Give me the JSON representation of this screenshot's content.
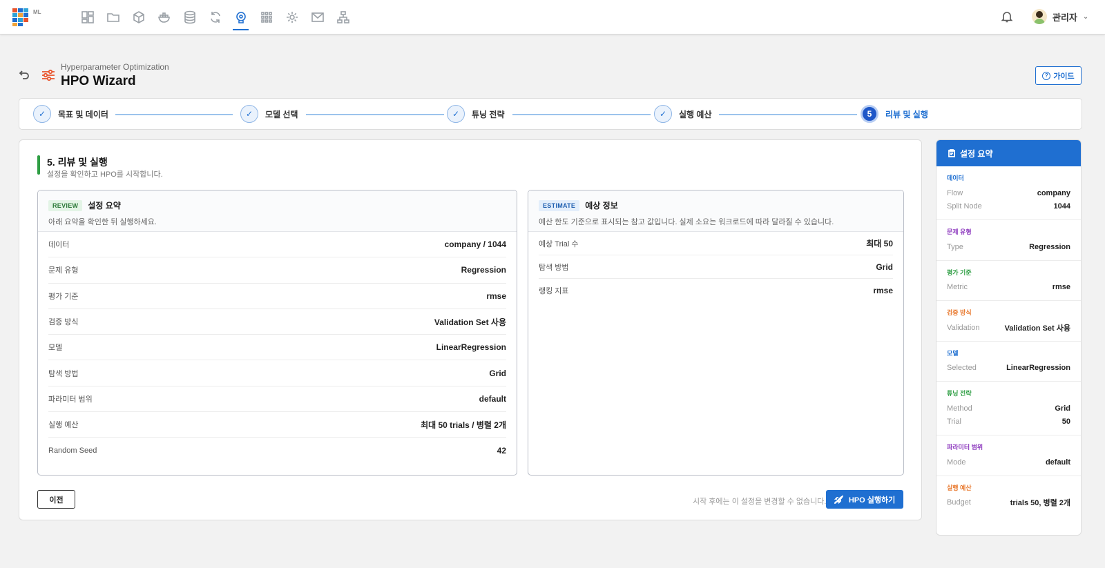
{
  "app": {
    "logo_suffix": "ML",
    "nav_icons": [
      "dashboard-icon",
      "folder-icon",
      "cube-icon",
      "docker-icon",
      "database-icon",
      "sync-icon",
      "brain-icon",
      "apps-grid-icon",
      "settings-icon",
      "mail-icon",
      "network-icon"
    ],
    "active_nav": "brain-icon",
    "user_name": "관리자"
  },
  "header": {
    "subtitle": "Hyperparameter Optimization",
    "title": "HPO Wizard",
    "guide_label": "가이드"
  },
  "stepper": {
    "steps": [
      {
        "label": "목표 및 데이터",
        "status": "done"
      },
      {
        "label": "모델 선택",
        "status": "done"
      },
      {
        "label": "튜닝 전략",
        "status": "done"
      },
      {
        "label": "실행 예산",
        "status": "done"
      },
      {
        "label": "리뷰 및 실행",
        "status": "current",
        "number": "5"
      }
    ]
  },
  "section": {
    "title": "5. 리뷰 및 실행",
    "subtitle": "설정을 확인하고 HPO를 시작합니다."
  },
  "review_panel": {
    "badge": "REVIEW",
    "title": "설정 요약",
    "desc": "아래 요약을 확인한 뒤 실행하세요.",
    "rows": [
      {
        "key": "데이터",
        "value": "company / 1044"
      },
      {
        "key": "문제 유형",
        "value": "Regression"
      },
      {
        "key": "평가 기준",
        "value": "rmse"
      },
      {
        "key": "검증 방식",
        "value": "Validation Set 사용"
      },
      {
        "key": "모델",
        "value": "LinearRegression"
      },
      {
        "key": "탐색 방법",
        "value": "Grid"
      },
      {
        "key": "파라미터 범위",
        "value": "default"
      },
      {
        "key": "실행 예산",
        "value": "최대 50 trials / 병렬 2개"
      },
      {
        "key": "Random Seed",
        "value": "42"
      }
    ]
  },
  "estimate_panel": {
    "badge": "ESTIMATE",
    "title": "예상 정보",
    "desc": "예산 한도 기준으로 표시되는 참고 값입니다. 실제 소요는 워크로드에 따라 달라질 수 있습니다.",
    "rows": [
      {
        "key": "예상 Trial 수",
        "value": "최대 50"
      },
      {
        "key": "탐색 방법",
        "value": "Grid"
      },
      {
        "key": "랭킹 지표",
        "value": "rmse"
      }
    ]
  },
  "actions": {
    "prev_label": "이전",
    "warning": "시작 후에는 이 설정을 변경할 수 없습니다.",
    "run_label": "HPO 실행하기"
  },
  "sidebar": {
    "title": "설정 요약",
    "sections": [
      {
        "category": "데이터",
        "color": "#1f6fd1",
        "rows": [
          {
            "key": "Flow",
            "value": "company"
          },
          {
            "key": "Split Node",
            "value": "1044"
          }
        ]
      },
      {
        "category": "문제 유형",
        "color": "#8e3bbf",
        "rows": [
          {
            "key": "Type",
            "value": "Regression"
          }
        ]
      },
      {
        "category": "평가 기준",
        "color": "#2f9e44",
        "rows": [
          {
            "key": "Metric",
            "value": "rmse"
          }
        ]
      },
      {
        "category": "검증 방식",
        "color": "#e8782d",
        "rows": [
          {
            "key": "Validation",
            "value": "Validation Set 사용"
          }
        ]
      },
      {
        "category": "모델",
        "color": "#1f6fd1",
        "rows": [
          {
            "key": "Selected",
            "value": "LinearRegression"
          }
        ]
      },
      {
        "category": "튜닝 전략",
        "color": "#2f9e44",
        "rows": [
          {
            "key": "Method",
            "value": "Grid"
          },
          {
            "key": "Trial",
            "value": "50"
          }
        ]
      },
      {
        "category": "파라미터 범위",
        "color": "#8e3bbf",
        "rows": [
          {
            "key": "Mode",
            "value": "default"
          }
        ]
      },
      {
        "category": "실행 예산",
        "color": "#e8782d",
        "rows": [
          {
            "key": "Budget",
            "value": "trials 50, 병렬 2개"
          }
        ]
      }
    ]
  }
}
